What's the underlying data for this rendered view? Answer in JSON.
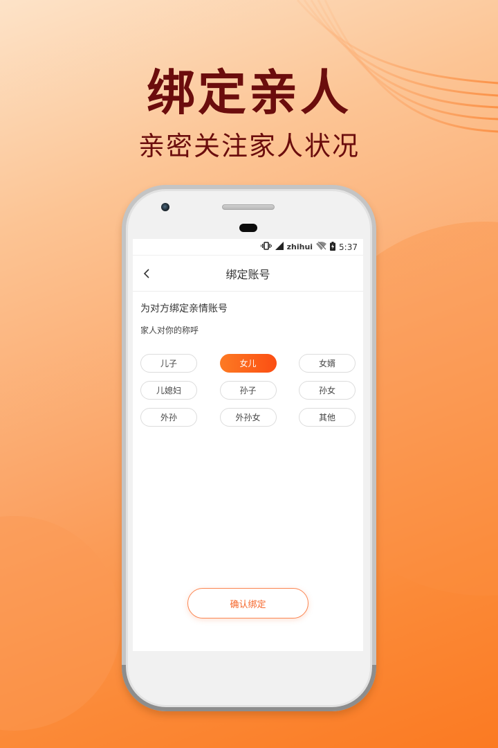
{
  "promo": {
    "headline": "绑定亲人",
    "subline": "亲密关注家人状况"
  },
  "colors": {
    "headline": "#6b0d0d",
    "accent_start": "#fd7a23",
    "accent_end": "#fb4e13",
    "confirm_text": "#f5662a"
  },
  "statusbar": {
    "icons": [
      "vibrate-icon",
      "signal-icon",
      "wifi-off-icon",
      "battery-charging-icon"
    ],
    "carrier": "zhihui",
    "time": "5:37"
  },
  "navbar": {
    "back_icon": "chevron-left-icon",
    "title": "绑定账号"
  },
  "form": {
    "section_title": "为对方绑定亲情账号",
    "section_sub": "家人对你的称呼",
    "options": [
      {
        "label": "儿子",
        "selected": false
      },
      {
        "label": "女儿",
        "selected": true
      },
      {
        "label": "女婿",
        "selected": false
      },
      {
        "label": "儿媳妇",
        "selected": false
      },
      {
        "label": "孙子",
        "selected": false
      },
      {
        "label": "孙女",
        "selected": false
      },
      {
        "label": "外孙",
        "selected": false
      },
      {
        "label": "外孙女",
        "selected": false
      },
      {
        "label": "其他",
        "selected": false
      }
    ],
    "confirm_label": "确认绑定"
  }
}
